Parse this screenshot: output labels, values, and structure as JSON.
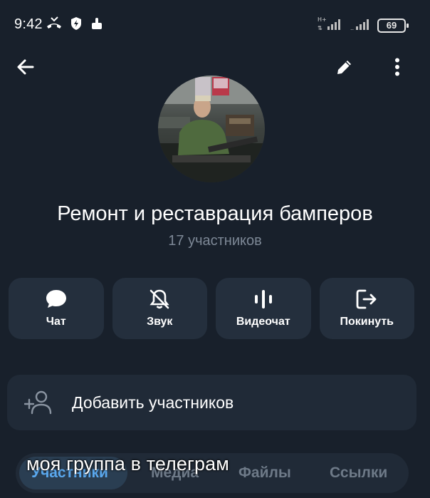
{
  "status_bar": {
    "time": "9:42",
    "battery": "69",
    "icons_left": [
      "missed-call-icon",
      "shield-bolt-icon",
      "thumb-icon"
    ],
    "icons_right": [
      "signal-hplus-icon",
      "signal-icon"
    ]
  },
  "app_bar": {
    "icons": [
      "back-arrow-icon",
      "pencil-icon",
      "more-vert-icon"
    ]
  },
  "group": {
    "title": "Ремонт и реставрация бамперов",
    "subtitle": "17 участников"
  },
  "actions": [
    {
      "label": "Чат",
      "icon": "chat-bubble-icon"
    },
    {
      "label": "Звук",
      "icon": "bell-off-icon"
    },
    {
      "label": "Видеочат",
      "icon": "voice-chat-icon"
    },
    {
      "label": "Покинуть",
      "icon": "leave-icon"
    }
  ],
  "add_members": {
    "label": "Добавить участников",
    "icon": "add-person-icon"
  },
  "tabs": [
    {
      "label": "Участники",
      "active": true
    },
    {
      "label": "Медиа",
      "active": false
    },
    {
      "label": "Файлы",
      "active": false
    },
    {
      "label": "Ссылки",
      "active": false
    }
  ],
  "overlay_caption": "моя группа в телеграм",
  "colors": {
    "background": "#18202b",
    "card": "#242f3d",
    "accent": "#5aa8ee",
    "muted_text": "#7d8896"
  }
}
